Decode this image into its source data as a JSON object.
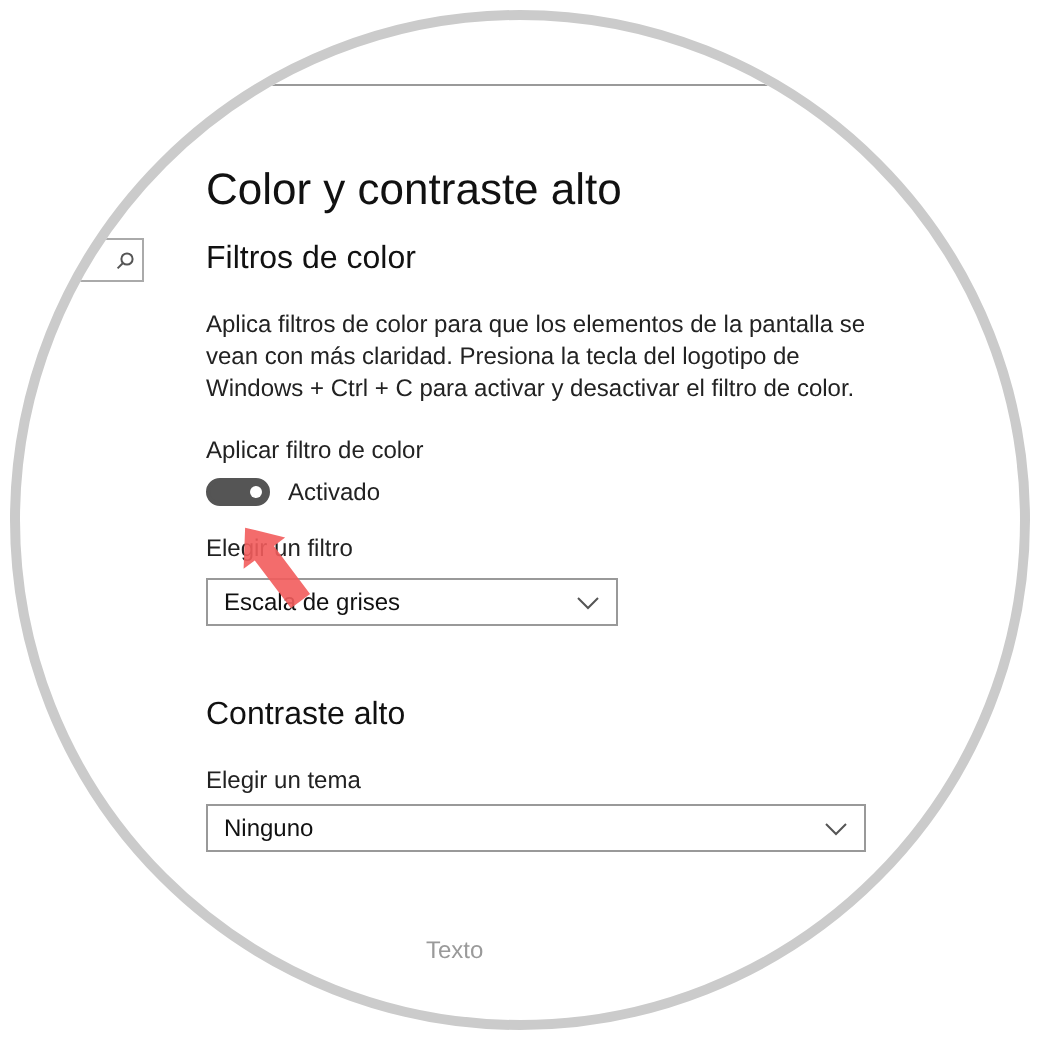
{
  "page": {
    "title": "Color y contraste alto"
  },
  "color_filters": {
    "heading": "Filtros de color",
    "description": "Aplica filtros de color para que los elementos de la pantalla se vean con más claridad. Presiona la tecla del logotipo de Windows + Ctrl + C para activar y desactivar el filtro de color.",
    "toggle": {
      "label": "Aplicar filtro de color",
      "on": true,
      "state_text": "Activado"
    },
    "filter": {
      "label": "Elegir un filtro",
      "value": "Escala de grises"
    }
  },
  "high_contrast": {
    "heading": "Contraste alto",
    "theme": {
      "label": "Elegir un tema",
      "value": "Ninguno"
    }
  },
  "footer": {
    "text": "Texto"
  }
}
